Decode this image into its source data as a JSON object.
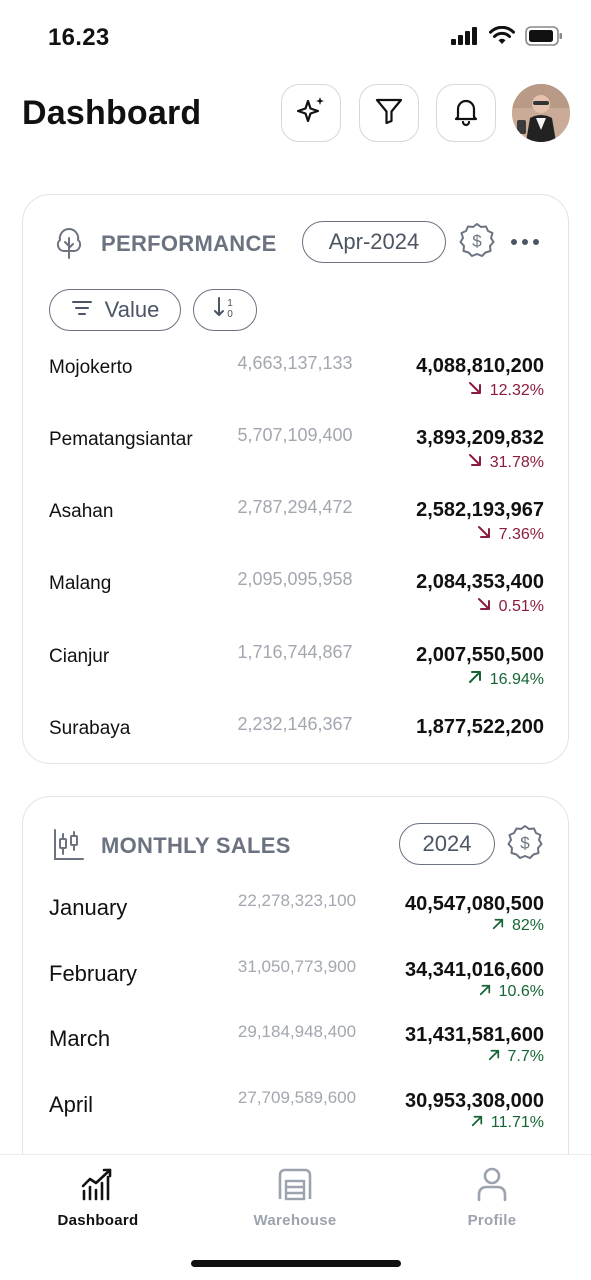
{
  "status_bar": {
    "time": "16.23"
  },
  "header": {
    "title": "Dashboard",
    "buttons": [
      "sparkle-icon",
      "filter-icon",
      "bell-icon"
    ]
  },
  "performance": {
    "title": "PERFORMANCE",
    "period": "Apr-2024",
    "filter_label": "Value",
    "rows": [
      {
        "name": "Mojokerto",
        "previous": "4,663,137,133",
        "current": "4,088,810,200",
        "change": "12.32%",
        "direction": "down"
      },
      {
        "name": "Pematangsiantar",
        "previous": "5,707,109,400",
        "current": "3,893,209,832",
        "change": "31.78%",
        "direction": "down"
      },
      {
        "name": "Asahan",
        "previous": "2,787,294,472",
        "current": "2,582,193,967",
        "change": "7.36%",
        "direction": "down"
      },
      {
        "name": "Malang",
        "previous": "2,095,095,958",
        "current": "2,084,353,400",
        "change": "0.51%",
        "direction": "down"
      },
      {
        "name": "Cianjur",
        "previous": "1,716,744,867",
        "current": "2,007,550,500",
        "change": "16.94%",
        "direction": "up"
      },
      {
        "name": "Surabaya",
        "previous": "2,232,146,367",
        "current": "1,877,522,200",
        "change": "",
        "direction": ""
      }
    ]
  },
  "monthly_sales": {
    "title": "MONTHLY SALES",
    "year": "2024",
    "rows": [
      {
        "name": "January",
        "previous": "22,278,323,100",
        "current": "40,547,080,500",
        "change": "82%",
        "direction": "up"
      },
      {
        "name": "February",
        "previous": "31,050,773,900",
        "current": "34,341,016,600",
        "change": "10.6%",
        "direction": "up"
      },
      {
        "name": "March",
        "previous": "29,184,948,400",
        "current": "31,431,581,600",
        "change": "7.7%",
        "direction": "up"
      },
      {
        "name": "April",
        "previous": "27,709,589,600",
        "current": "30,953,308,000",
        "change": "11.71%",
        "direction": "up"
      }
    ]
  },
  "bottom_nav": {
    "items": [
      {
        "label": "Dashboard",
        "active": true
      },
      {
        "label": "Warehouse",
        "active": false
      },
      {
        "label": "Profile",
        "active": false
      }
    ]
  },
  "colors": {
    "down": "#8a1c3c",
    "up": "#166534",
    "muted": "#a3a7b0",
    "accent_gray": "#6b7280"
  }
}
